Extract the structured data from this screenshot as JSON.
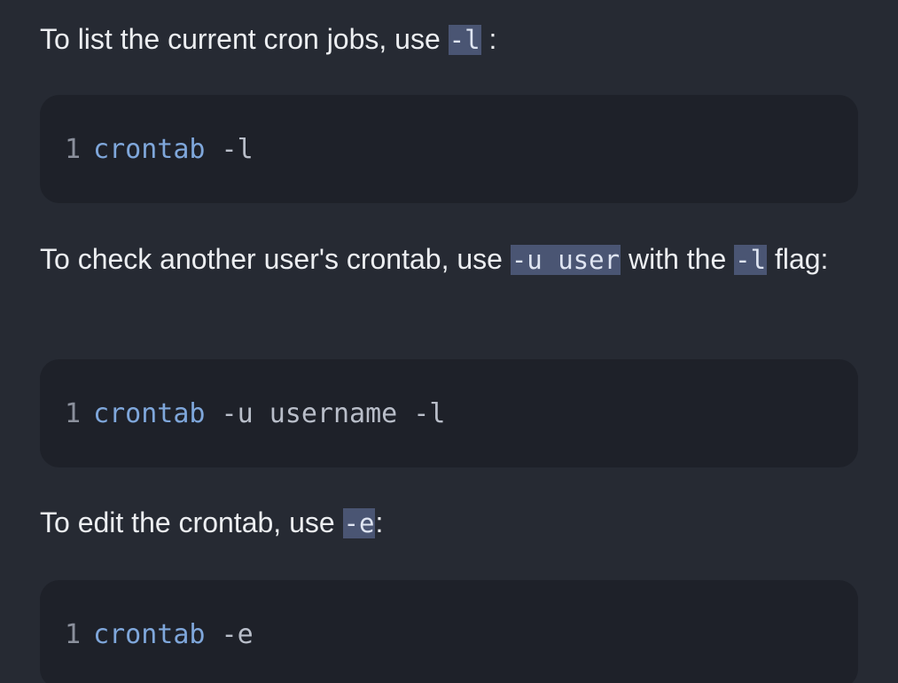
{
  "sections": [
    {
      "text_before": "To list the current cron jobs, use ",
      "inline_code": "-l",
      "text_after": " :",
      "code": {
        "line_number": "1",
        "command": "crontab",
        "args": " -l"
      }
    },
    {
      "text_before": "To check another user's crontab, use ",
      "inline_code": "-u user",
      "text_middle": " with the ",
      "inline_code_2": "-l",
      "text_after": " flag:",
      "code": {
        "line_number": "1",
        "command": "crontab",
        "args": " -u username -l"
      }
    },
    {
      "text_before": "To edit the crontab, use ",
      "inline_code": "-e",
      "text_after": ":",
      "code": {
        "line_number": "1",
        "command": "crontab",
        "args": " -e"
      }
    }
  ],
  "colors": {
    "background": "#262a33",
    "code_block_bg": "#1e2129",
    "inline_code_bg": "#4a5573",
    "keyword": "#7fa7db"
  }
}
